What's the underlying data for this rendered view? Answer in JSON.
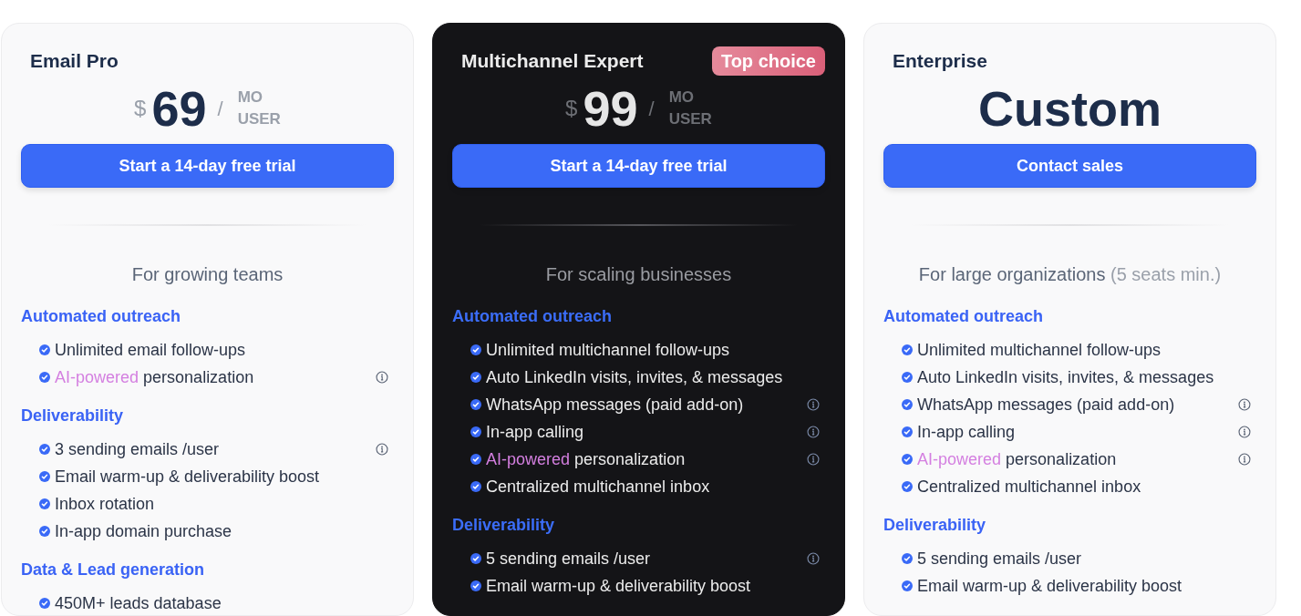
{
  "plans": [
    {
      "name": "Email Pro",
      "featured": false,
      "price": {
        "kind": "amount",
        "currency": "$",
        "amount": "69",
        "separator": "/",
        "period": "MO",
        "unit": "USER"
      },
      "button": "Start a 14-day free trial",
      "audience": "For growing teams",
      "sections": [
        {
          "title": "Automated outreach",
          "features": [
            {
              "text": "Unlimited email follow-ups",
              "info": false
            },
            {
              "highlight": "AI-powered",
              "text": "personalization",
              "info": true
            }
          ]
        },
        {
          "title": "Deliverability",
          "features": [
            {
              "text": "3 sending emails /user",
              "info": true
            },
            {
              "text": "Email warm-up & deliverability boost",
              "info": false
            },
            {
              "text": "Inbox rotation",
              "info": false
            },
            {
              "text": "In-app domain purchase",
              "info": false
            }
          ]
        },
        {
          "title": "Data & Lead generation",
          "features": [
            {
              "text": "450M+ leads database",
              "info": false
            }
          ]
        }
      ]
    },
    {
      "name": "Multichannel Expert",
      "featured": true,
      "badge": "Top choice",
      "price": {
        "kind": "amount",
        "currency": "$",
        "amount": "99",
        "separator": "/",
        "period": "MO",
        "unit": "USER"
      },
      "button": "Start a 14-day free trial",
      "audience": "For scaling businesses",
      "sections": [
        {
          "title": "Automated outreach",
          "features": [
            {
              "text": "Unlimited multichannel follow-ups",
              "info": false
            },
            {
              "text": "Auto LinkedIn visits, invites, & messages",
              "info": false
            },
            {
              "text": "WhatsApp messages (paid add-on)",
              "info": true
            },
            {
              "text": "In-app calling",
              "info": true
            },
            {
              "highlight": "AI-powered",
              "text": "personalization",
              "info": true
            },
            {
              "text": "Centralized multichannel inbox",
              "info": false
            }
          ]
        },
        {
          "title": "Deliverability",
          "features": [
            {
              "text": "5 sending emails /user",
              "info": true
            },
            {
              "text": "Email warm-up & deliverability boost",
              "info": false
            }
          ]
        }
      ]
    },
    {
      "name": "Enterprise",
      "featured": false,
      "price": {
        "kind": "custom",
        "label": "Custom"
      },
      "button": "Contact sales",
      "audience": "For large organizations",
      "audience_note": "(5 seats min.)",
      "sections": [
        {
          "title": "Automated outreach",
          "features": [
            {
              "text": "Unlimited multichannel follow-ups",
              "info": false
            },
            {
              "text": "Auto LinkedIn visits, invites, & messages",
              "info": false
            },
            {
              "text": "WhatsApp messages (paid add-on)",
              "info": true
            },
            {
              "text": "In-app calling",
              "info": true
            },
            {
              "highlight": "AI-powered",
              "text": "personalization",
              "info": true
            },
            {
              "text": "Centralized multichannel inbox",
              "info": false
            }
          ]
        },
        {
          "title": "Deliverability",
          "features": [
            {
              "text": "5 sending emails /user",
              "info": false
            },
            {
              "text": "Email warm-up & deliverability boost",
              "info": false
            }
          ]
        }
      ]
    }
  ]
}
